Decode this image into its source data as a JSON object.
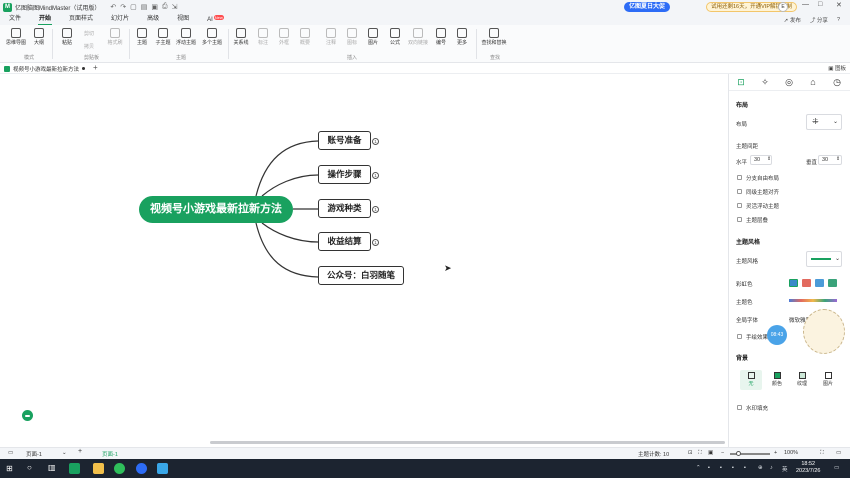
{
  "titlebar": {
    "logo": "M",
    "title": "亿图脑图MindMaster（试用版）",
    "promo": "亿图夏日大促",
    "vip": "试用还剩16天，开通VIP解锁限制",
    "user_initial": "E",
    "minimize": "—",
    "maximize": "□",
    "close": "✕"
  },
  "menu": {
    "items": [
      "文件",
      "开始",
      "页面样式",
      "幻灯片",
      "高级",
      "视图",
      "AI"
    ],
    "ai_tag": "New",
    "right": {
      "publish": "发布",
      "share": "分享",
      "help": "?"
    }
  },
  "ribbon": {
    "buttons": [
      {
        "label": "思维导图"
      },
      {
        "label": "大纲"
      },
      {
        "label": "粘贴"
      },
      {
        "label": "剪切"
      },
      {
        "label": "格式刷"
      },
      {
        "label": "主题"
      },
      {
        "label": "子主题"
      },
      {
        "label": "浮动主题"
      },
      {
        "label": "多个主题"
      },
      {
        "label": "关系线"
      },
      {
        "label": "标注"
      },
      {
        "label": "外框"
      },
      {
        "label": "概要"
      },
      {
        "label": "注释"
      },
      {
        "label": "图标"
      },
      {
        "label": "图片"
      },
      {
        "label": "公式"
      },
      {
        "label": "双向链接"
      },
      {
        "label": "编号"
      },
      {
        "label": "更多"
      },
      {
        "label": "查找和替换"
      }
    ],
    "small_buttons": [
      "复制",
      "拷贝"
    ],
    "groups": [
      "模式",
      "剪贴板",
      "主题",
      "插入",
      "查找"
    ]
  },
  "doc_tab": {
    "name": "视频号小游戏最新拉新方法",
    "add": "+",
    "panel_toggle": "图板"
  },
  "mindmap": {
    "root": "视频号小游戏最新拉新方法",
    "children": [
      "账号准备",
      "操作步骤",
      "游戏种类",
      "收益结算",
      "公众号：白羽随笔"
    ],
    "fold_symbol": "1"
  },
  "right_panel": {
    "tabs": [
      "layout-icon",
      "magic-icon",
      "location-icon",
      "theme-icon",
      "clock-icon"
    ],
    "layout_section": "布局",
    "layout_label": "布局",
    "spacing_label": "主题间距",
    "h_label": "水平",
    "h_value": "30",
    "v_label": "垂直",
    "v_value": "30",
    "checks": [
      "分支自由布局",
      "同级主题对齐",
      "灵活浮动主题",
      "主题层叠"
    ],
    "style_section": "主题风格",
    "style_label": "主题风格",
    "color_label": "彩虹色",
    "theme_color_label": "主题色",
    "font_label": "全局字体",
    "font_value": "微软雅黑",
    "hand_label": "手绘效果",
    "bg_section": "背景",
    "bg_options": [
      "无",
      "颜色",
      "纹理",
      "图片"
    ],
    "watermark_label": "水印填充",
    "assistant_badge": "08:43"
  },
  "statusbar": {
    "page_select": "页面-1",
    "add": "+",
    "page_tab": "页面-1",
    "topic_count": "主题计数: 10",
    "zoom": "100%"
  },
  "taskbar": {
    "time": "18:52",
    "date": "2023/7/26",
    "tray_text": "英"
  }
}
